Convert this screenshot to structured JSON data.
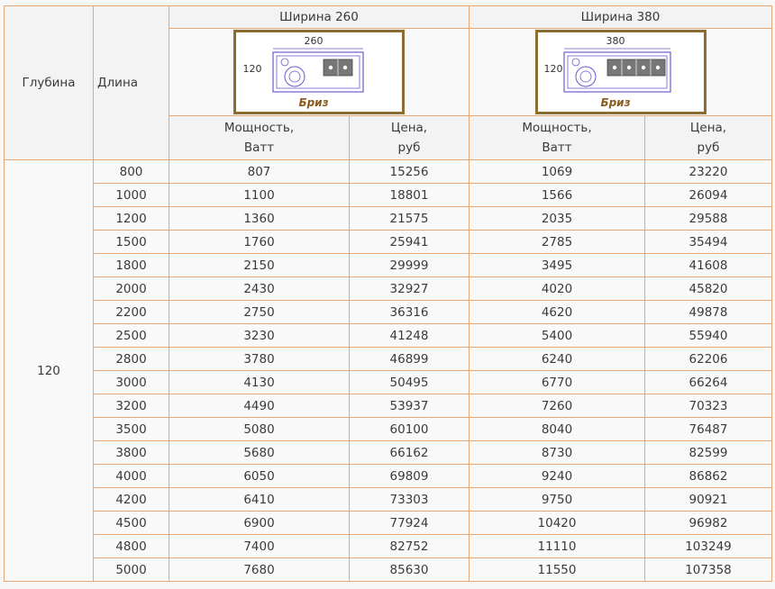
{
  "header": {
    "depth_label": "Глубина",
    "length_label": "Длина",
    "group_260": {
      "title": "Ширина 260",
      "diagram_width": "260",
      "diagram_height": "120",
      "diagram_caption": "Бриз",
      "power_line1": "Мощность,",
      "power_line2": "Ватт",
      "price_line1": "Цена,",
      "price_line2": "руб"
    },
    "group_380": {
      "title": "Ширина 380",
      "diagram_width": "380",
      "diagram_height": "120",
      "diagram_caption": "Бриз",
      "power_line1": "Мощность,",
      "power_line2": "Ватт",
      "price_line1": "Цена,",
      "price_line2": "руб"
    }
  },
  "depth_value": "120",
  "rows": [
    {
      "length": "800",
      "p260": "807",
      "c260": "15256",
      "p380": "1069",
      "c380": "23220"
    },
    {
      "length": "1000",
      "p260": "1100",
      "c260": "18801",
      "p380": "1566",
      "c380": "26094"
    },
    {
      "length": "1200",
      "p260": "1360",
      "c260": "21575",
      "p380": "2035",
      "c380": "29588"
    },
    {
      "length": "1500",
      "p260": "1760",
      "c260": "25941",
      "p380": "2785",
      "c380": "35494"
    },
    {
      "length": "1800",
      "p260": "2150",
      "c260": "29999",
      "p380": "3495",
      "c380": "41608"
    },
    {
      "length": "2000",
      "p260": "2430",
      "c260": "32927",
      "p380": "4020",
      "c380": "45820"
    },
    {
      "length": "2200",
      "p260": "2750",
      "c260": "36316",
      "p380": "4620",
      "c380": "49878"
    },
    {
      "length": "2500",
      "p260": "3230",
      "c260": "41248",
      "p380": "5400",
      "c380": "55940"
    },
    {
      "length": "2800",
      "p260": "3780",
      "c260": "46899",
      "p380": "6240",
      "c380": "62206"
    },
    {
      "length": "3000",
      "p260": "4130",
      "c260": "50495",
      "p380": "6770",
      "c380": "66264"
    },
    {
      "length": "3200",
      "p260": "4490",
      "c260": "53937",
      "p380": "7260",
      "c380": "70323"
    },
    {
      "length": "3500",
      "p260": "5080",
      "c260": "60100",
      "p380": "8040",
      "c380": "76487"
    },
    {
      "length": "3800",
      "p260": "5680",
      "c260": "66162",
      "p380": "8730",
      "c380": "82599"
    },
    {
      "length": "4000",
      "p260": "6050",
      "c260": "69809",
      "p380": "9240",
      "c380": "86862"
    },
    {
      "length": "4200",
      "p260": "6410",
      "c260": "73303",
      "p380": "9750",
      "c380": "90921"
    },
    {
      "length": "4500",
      "p260": "6900",
      "c260": "77924",
      "p380": "10420",
      "c380": "96982"
    },
    {
      "length": "4800",
      "p260": "7400",
      "c260": "82752",
      "p380": "11110",
      "c380": "103249"
    },
    {
      "length": "5000",
      "p260": "7680",
      "c260": "85630",
      "p380": "11550",
      "c380": "107358"
    }
  ],
  "colors": {
    "border": "#e8a876",
    "frame": "#8a6d2f",
    "drawing": "#6a5acd",
    "caption": "#8a5a1e"
  }
}
